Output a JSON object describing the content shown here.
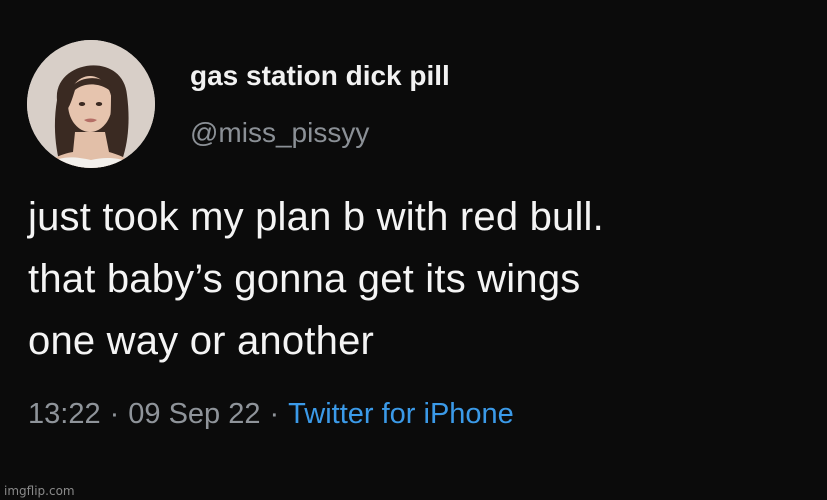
{
  "tweet": {
    "display_name": "gas station dick pill",
    "handle": "@miss_pissyy",
    "text_lines": [
      "just took my plan b with red bull.",
      "that baby’s gonna get its wings",
      "one way or another"
    ],
    "time": "13:22",
    "separator": "·",
    "date": "09 Sep 22",
    "source": "Twitter for iPhone"
  },
  "watermark": "imgflip.com",
  "colors": {
    "background": "#0b0b0b",
    "text_primary": "#f4f4f4",
    "text_secondary": "#8f949a",
    "link": "#3b9ae8"
  },
  "icons": {
    "avatar": "profile-photo"
  }
}
